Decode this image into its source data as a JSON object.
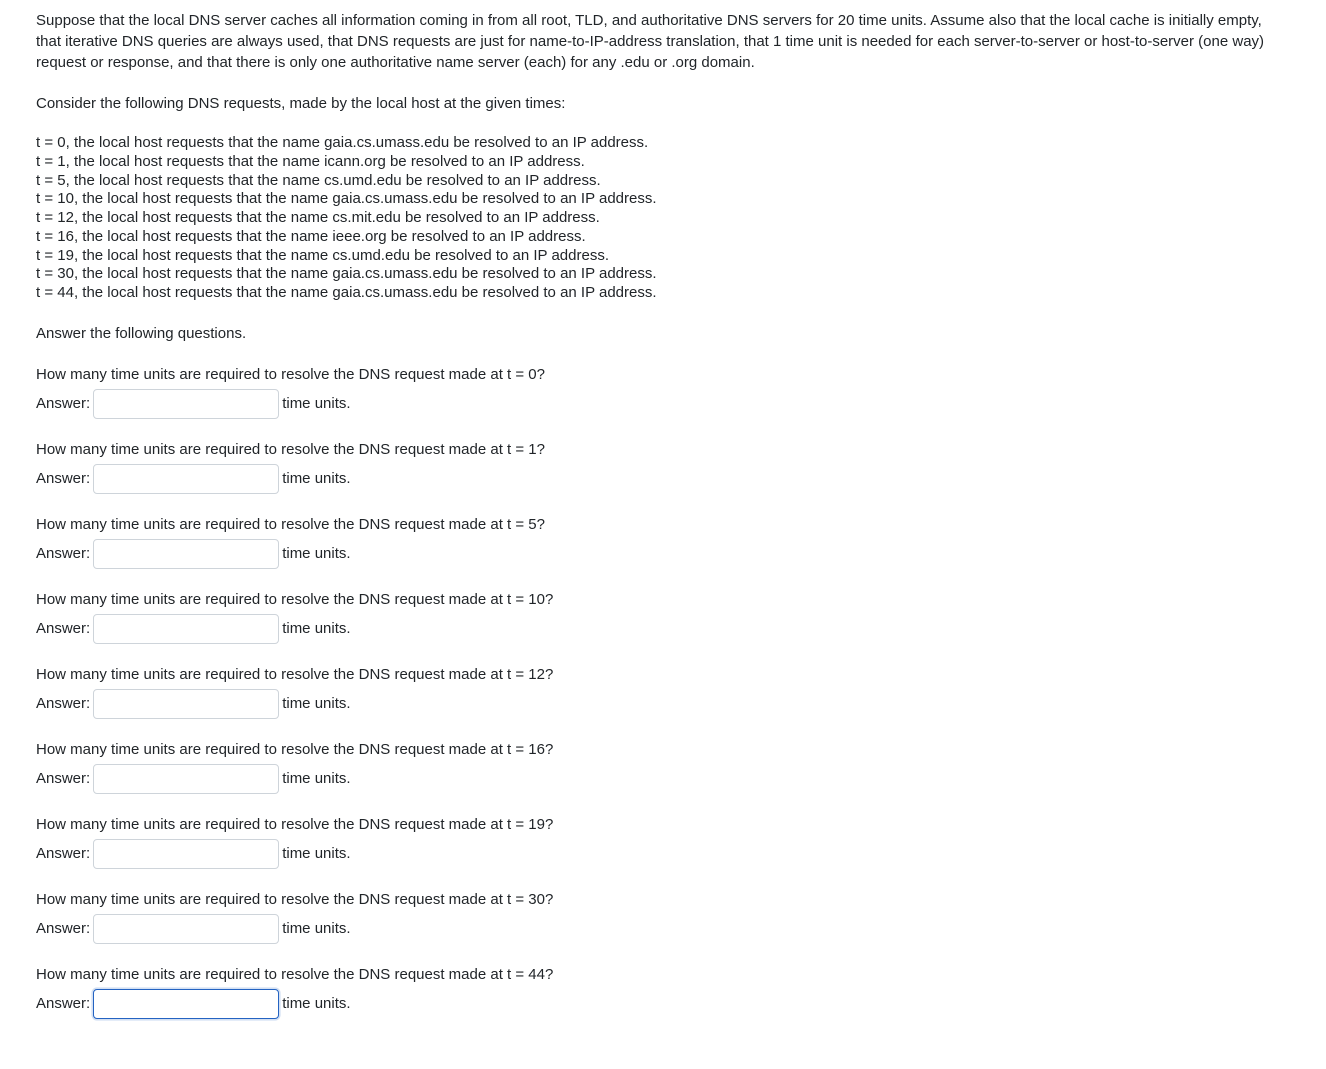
{
  "intro": "Suppose that the local DNS server caches all information coming in from all root, TLD, and authoritative DNS servers for 20 time units. Assume also that the local cache is initially empty, that iterative DNS queries are always used, that DNS requests are just for name-to-IP-address translation, that 1 time unit is needed for each server-to-server or host-to-server (one way) request or response, and that there is only one authoritative name server (each) for any .edu or .org domain.",
  "requests_intro": "Consider the following DNS requests, made by the local host at the given times:",
  "requests": [
    "t = 0, the local host requests that the name gaia.cs.umass.edu be resolved to an IP address.",
    "t = 1, the local host requests that the name icann.org be resolved to an IP address.",
    "t = 5, the local host requests that the name cs.umd.edu be resolved to an IP address.",
    "t = 10, the local host requests that the name gaia.cs.umass.edu be resolved to an IP address.",
    "t = 12, the local host requests that the name cs.mit.edu be resolved to an IP address.",
    "t = 16, the local host requests that the name ieee.org be resolved to an IP address.",
    "t = 19, the local host requests that the name cs.umd.edu be resolved to an IP address.",
    "t = 30, the local host requests that the name gaia.cs.umass.edu be resolved to an IP address.",
    "t = 44, the local host requests that the name gaia.cs.umass.edu be resolved to an IP address."
  ],
  "instruction": "Answer the following questions.",
  "answer_label": "Answer:",
  "units": "time units.",
  "questions": [
    {
      "text": "How many time units are required to resolve the DNS request made at t = 0?",
      "focused": false
    },
    {
      "text": "How many time units are required to resolve the DNS request made at t = 1?",
      "focused": false
    },
    {
      "text": "How many time units are required to resolve the DNS request made at t = 5?",
      "focused": false
    },
    {
      "text": "How many time units are required to resolve the DNS request made at t = 10?",
      "focused": false
    },
    {
      "text": "How many time units are required to resolve the DNS request made at t = 12?",
      "focused": false
    },
    {
      "text": "How many time units are required to resolve the DNS request made at t = 16?",
      "focused": false
    },
    {
      "text": "How many time units are required to resolve the DNS request made at t = 19?",
      "focused": false
    },
    {
      "text": "How many time units are required to resolve the DNS request made at t = 30?",
      "focused": false
    },
    {
      "text": "How many time units are required to resolve the DNS request made at t = 44?",
      "focused": true
    }
  ]
}
